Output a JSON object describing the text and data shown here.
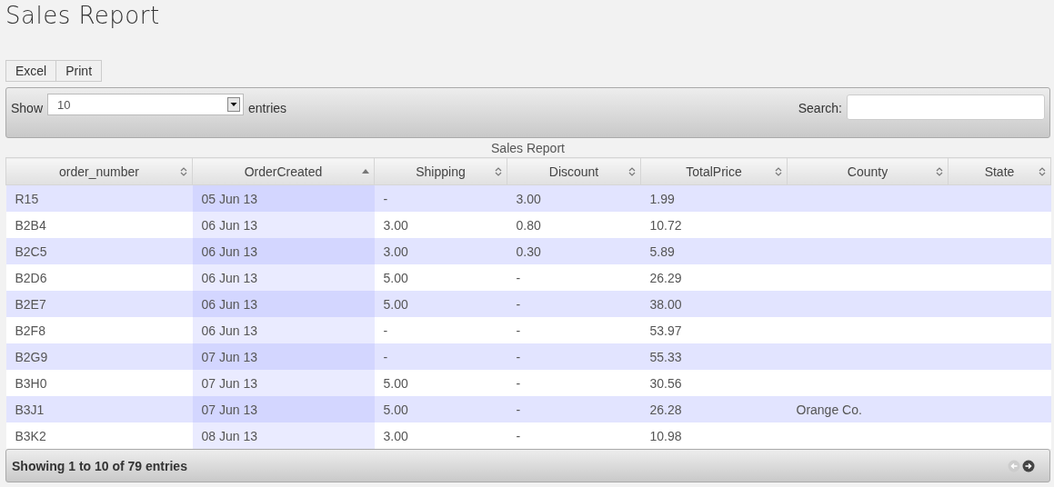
{
  "title": "Sales Report",
  "buttons": [
    "Excel",
    "Print"
  ],
  "length": {
    "label_before": "Show",
    "value": "10",
    "label_after": "entries"
  },
  "search": {
    "label": "Search:"
  },
  "table": {
    "caption": "Sales Report",
    "columns": [
      {
        "label": "order_number",
        "sorted": false
      },
      {
        "label": "OrderCreated",
        "sorted": true
      },
      {
        "label": "Shipping",
        "sorted": false
      },
      {
        "label": "Discount",
        "sorted": false
      },
      {
        "label": "TotalPrice",
        "sorted": false
      },
      {
        "label": "County",
        "sorted": false
      },
      {
        "label": "State",
        "sorted": false
      }
    ],
    "rows": [
      [
        "R15",
        "05 Jun 13",
        "-",
        "3.00",
        "1.99",
        "",
        ""
      ],
      [
        "B2B4",
        "06 Jun 13",
        "3.00",
        "0.80",
        "10.72",
        "",
        ""
      ],
      [
        "B2C5",
        "06 Jun 13",
        "3.00",
        "0.30",
        "5.89",
        "",
        ""
      ],
      [
        "B2D6",
        "06 Jun 13",
        "5.00",
        "-",
        "26.29",
        "",
        ""
      ],
      [
        "B2E7",
        "06 Jun 13",
        "5.00",
        "-",
        "38.00",
        "",
        ""
      ],
      [
        "B2F8",
        "06 Jun 13",
        "-",
        "-",
        "53.97",
        "",
        ""
      ],
      [
        "B2G9",
        "07 Jun 13",
        "-",
        "-",
        "55.33",
        "",
        ""
      ],
      [
        "B3H0",
        "07 Jun 13",
        "5.00",
        "-",
        "30.56",
        "",
        ""
      ],
      [
        "B3J1",
        "07 Jun 13",
        "5.00",
        "-",
        "26.28",
        "Orange Co.",
        ""
      ],
      [
        "B3K2",
        "08 Jun 13",
        "3.00",
        "-",
        "10.98",
        "",
        ""
      ]
    ]
  },
  "footer": {
    "info": "Showing 1 to 10 of 79 entries",
    "previous_enabled": false,
    "next_enabled": true
  }
}
